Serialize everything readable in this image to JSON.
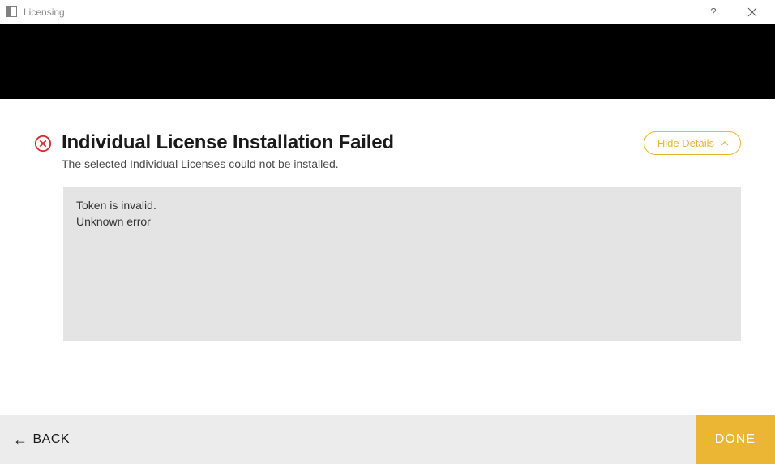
{
  "window": {
    "title": "Licensing"
  },
  "header": {
    "title": "Individual License Installation Failed",
    "subtitle": "The selected Individual Licenses could not be installed.",
    "hide_details_label": "Hide Details"
  },
  "details": {
    "text": "Token is invalid.\nUnknown error"
  },
  "footer": {
    "back_label": "BACK",
    "done_label": "DONE"
  },
  "colors": {
    "accent": "#eab634",
    "error": "#d9292f"
  }
}
